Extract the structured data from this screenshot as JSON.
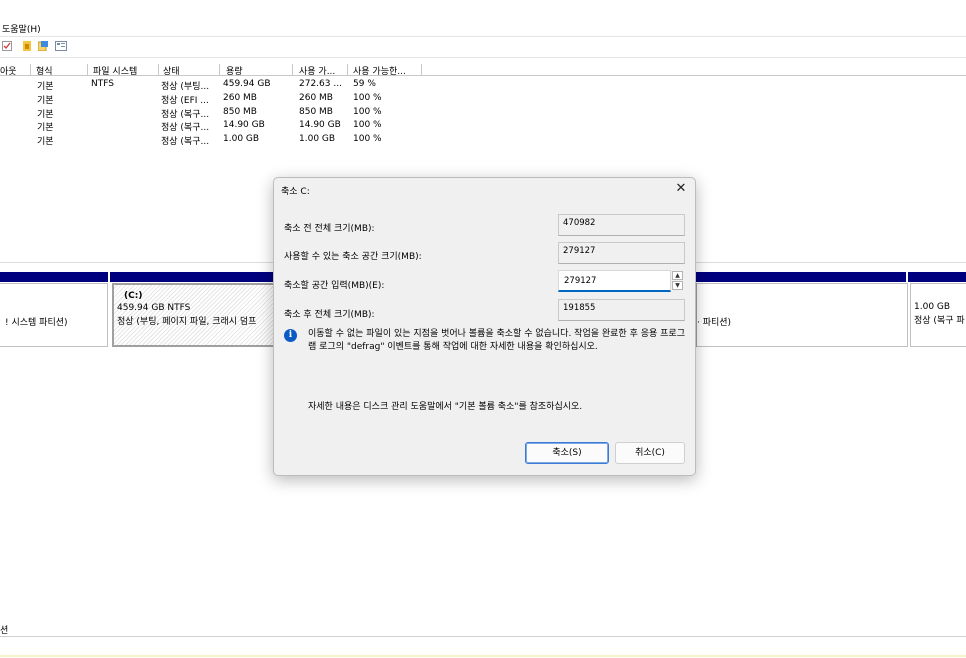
{
  "menu": {
    "help": "도움말(H)"
  },
  "volumes": {
    "columns": [
      "아웃",
      "형식",
      "파일 시스템",
      "상태",
      "용량",
      "사용 가...",
      "사용 가능한..."
    ],
    "rows": [
      {
        "type": "기본",
        "fs": "NTFS",
        "status": "정상 (부팅...",
        "capacity": "459.94 GB",
        "free": "272.63 ...",
        "pct": "59 %"
      },
      {
        "type": "기본",
        "fs": "",
        "status": "정상 (EFI ...",
        "capacity": "260 MB",
        "free": "260 MB",
        "pct": "100 %"
      },
      {
        "type": "기본",
        "fs": "",
        "status": "정상 (복구...",
        "capacity": "850 MB",
        "free": "850 MB",
        "pct": "100 %"
      },
      {
        "type": "기본",
        "fs": "",
        "status": "정상 (복구...",
        "capacity": "14.90 GB",
        "free": "14.90 GB",
        "pct": "100 %"
      },
      {
        "type": "기본",
        "fs": "",
        "status": "정상 (복구...",
        "capacity": "1.00 GB",
        "free": "1.00 GB",
        "pct": "100 %"
      }
    ]
  },
  "diskmap": {
    "left_partition": "! 시스템 파티션)",
    "c_label": "(C:)",
    "c_size": "459.94 GB NTFS",
    "c_status": "정상 (부팅, 페이지 파일, 크래시 덤프",
    "mid_partition": "· 파티션)",
    "right_size": "1.00 GB",
    "right_status": "정상 (복구 파"
  },
  "status_bar": {
    "label": "션"
  },
  "dialog": {
    "title": "축소 C:",
    "close_glyph": "✕",
    "total_before_label": "축소 전 전체 크기(MB):",
    "total_before_value": "470982",
    "available_label": "사용할 수 있는 축소 공간 크기(MB):",
    "available_value": "279127",
    "enter_label": "축소할 공간 입력(MB)(E):",
    "enter_value": "279127",
    "total_after_label": "축소 후 전체 크기(MB):",
    "total_after_value": "191855",
    "info_glyph": "i",
    "info_text": "이동할 수 없는 파일이 있는 지점을 벗어나 볼륨을 축소할 수 없습니다. 작업을 완료한 후 응용 프로그램 로그의 \"defrag\" 이벤트를 통해 작업에 대한 자세한 내용을 확인하십시오.",
    "reference_text": "자세한 내용은 디스크 관리 도움말에서 \"기본 볼륨 축소\"를 참조하십시오.",
    "shrink_button": "축소(S)",
    "cancel_button": "취소(C)"
  }
}
